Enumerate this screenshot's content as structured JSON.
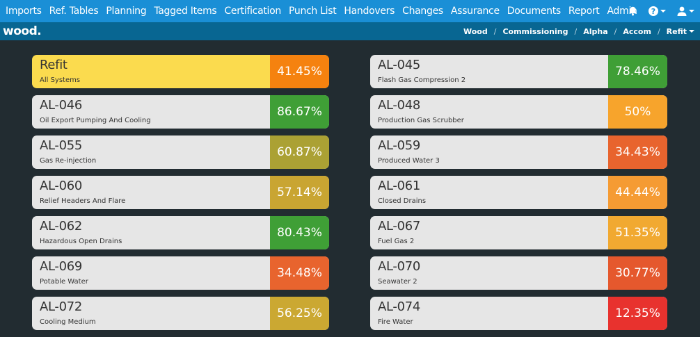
{
  "nav": {
    "items": [
      "Imports",
      "Ref. Tables",
      "Planning",
      "Tagged Items",
      "Certification",
      "Punch List",
      "Handovers",
      "Changes",
      "Assurance",
      "Documents",
      "Report",
      "Admin"
    ],
    "icons": [
      "bell-icon",
      "help-icon",
      "user-icon"
    ]
  },
  "brand": {
    "logo": "wood."
  },
  "breadcrumb": [
    "Wood",
    "Commissioning",
    "Alpha",
    "Accom",
    "Refit"
  ],
  "summary": {
    "name": "Refit",
    "description": "All Systems",
    "percent": "41.45%",
    "color": "#f5820f"
  },
  "systems": [
    {
      "name": "AL-045",
      "description": "Flash Gas Compression 2",
      "percent": "78.46%",
      "color": "#3f9f36"
    },
    {
      "name": "AL-046",
      "description": "Oil Export Pumping And Cooling",
      "percent": "86.67%",
      "color": "#3f9f36"
    },
    {
      "name": "AL-048",
      "description": "Production Gas Scrubber",
      "percent": "50%",
      "color": "#f7a42c"
    },
    {
      "name": "AL-055",
      "description": "Gas Re-injection",
      "percent": "60.87%",
      "color": "#aba134"
    },
    {
      "name": "AL-059",
      "description": "Produced Water 3",
      "percent": "34.43%",
      "color": "#e8642e"
    },
    {
      "name": "AL-060",
      "description": "Relief Headers And Flare",
      "percent": "57.14%",
      "color": "#c9a532"
    },
    {
      "name": "AL-061",
      "description": "Closed Drains",
      "percent": "44.44%",
      "color": "#f59b33"
    },
    {
      "name": "AL-062",
      "description": "Hazardous Open Drains",
      "percent": "80.43%",
      "color": "#3f9f36"
    },
    {
      "name": "AL-067",
      "description": "Fuel Gas 2",
      "percent": "51.35%",
      "color": "#f1a931"
    },
    {
      "name": "AL-069",
      "description": "Potable Water",
      "percent": "34.48%",
      "color": "#e8642e"
    },
    {
      "name": "AL-070",
      "description": "Seawater 2",
      "percent": "30.77%",
      "color": "#e5582d"
    },
    {
      "name": "AL-072",
      "description": "Cooling Medium",
      "percent": "56.25%",
      "color": "#cba832"
    },
    {
      "name": "AL-074",
      "description": "Fire Water",
      "percent": "12.35%",
      "color": "#e8322e"
    }
  ]
}
